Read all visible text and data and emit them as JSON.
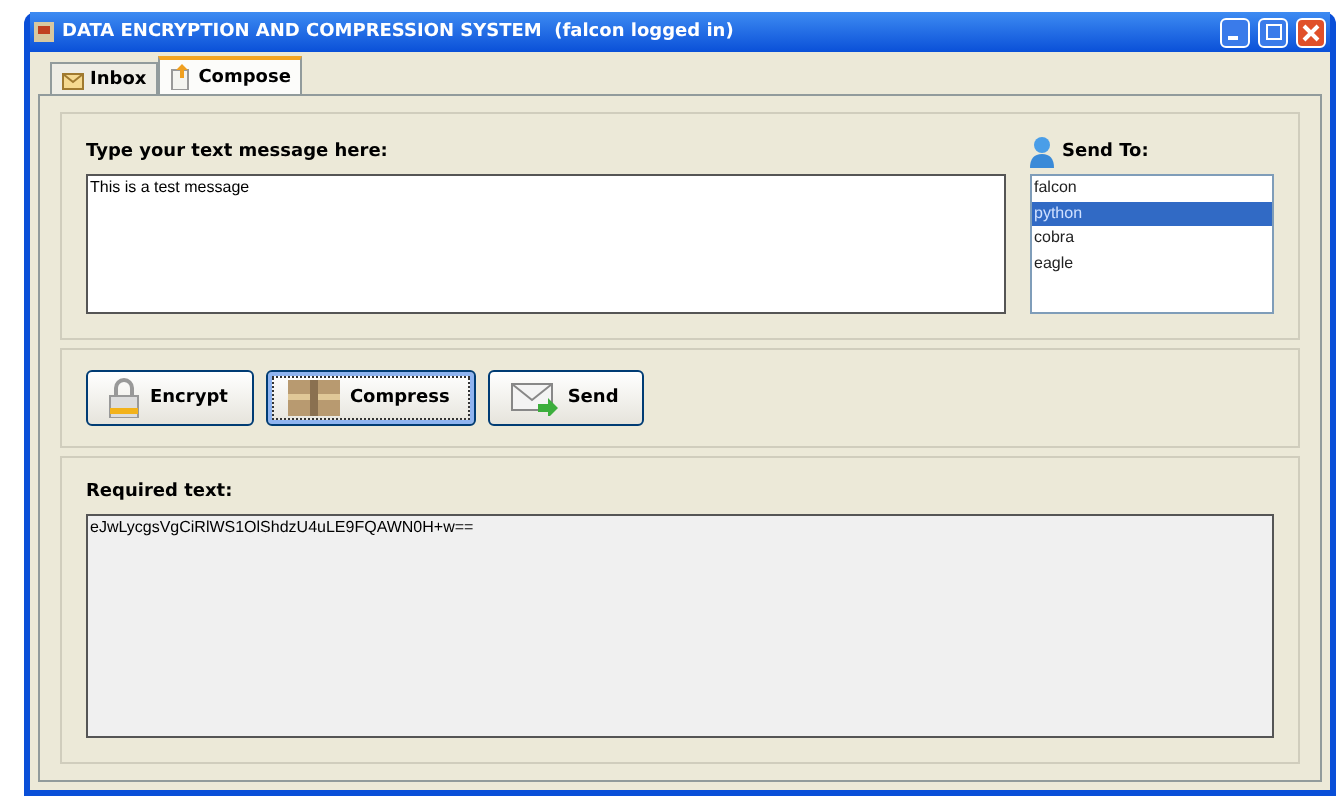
{
  "window": {
    "title": "DATA ENCRYPTION AND COMPRESSION SYSTEM  (falcon logged in)"
  },
  "tabs": [
    {
      "label": "Inbox",
      "kind": "inbox",
      "selected": false
    },
    {
      "label": "Compose",
      "kind": "compose",
      "selected": true
    }
  ],
  "message": {
    "label": "Type your text message here:",
    "value": "This is a test message"
  },
  "send_to": {
    "label": "Send To:",
    "recipients": [
      {
        "name": "falcon",
        "selected": false
      },
      {
        "name": "python",
        "selected": true
      },
      {
        "name": "cobra",
        "selected": false
      },
      {
        "name": "eagle",
        "selected": false
      }
    ]
  },
  "buttons": [
    {
      "label": "Encrypt",
      "kind": "encrypt",
      "focused": false
    },
    {
      "label": "Compress",
      "kind": "compress",
      "focused": true
    },
    {
      "label": "Send",
      "kind": "send",
      "focused": false
    }
  ],
  "result": {
    "label": "Required text:",
    "value": "eJwLycgsVgCiRlWS1OlShdzU4uLE9FQAWN0H+w=="
  }
}
